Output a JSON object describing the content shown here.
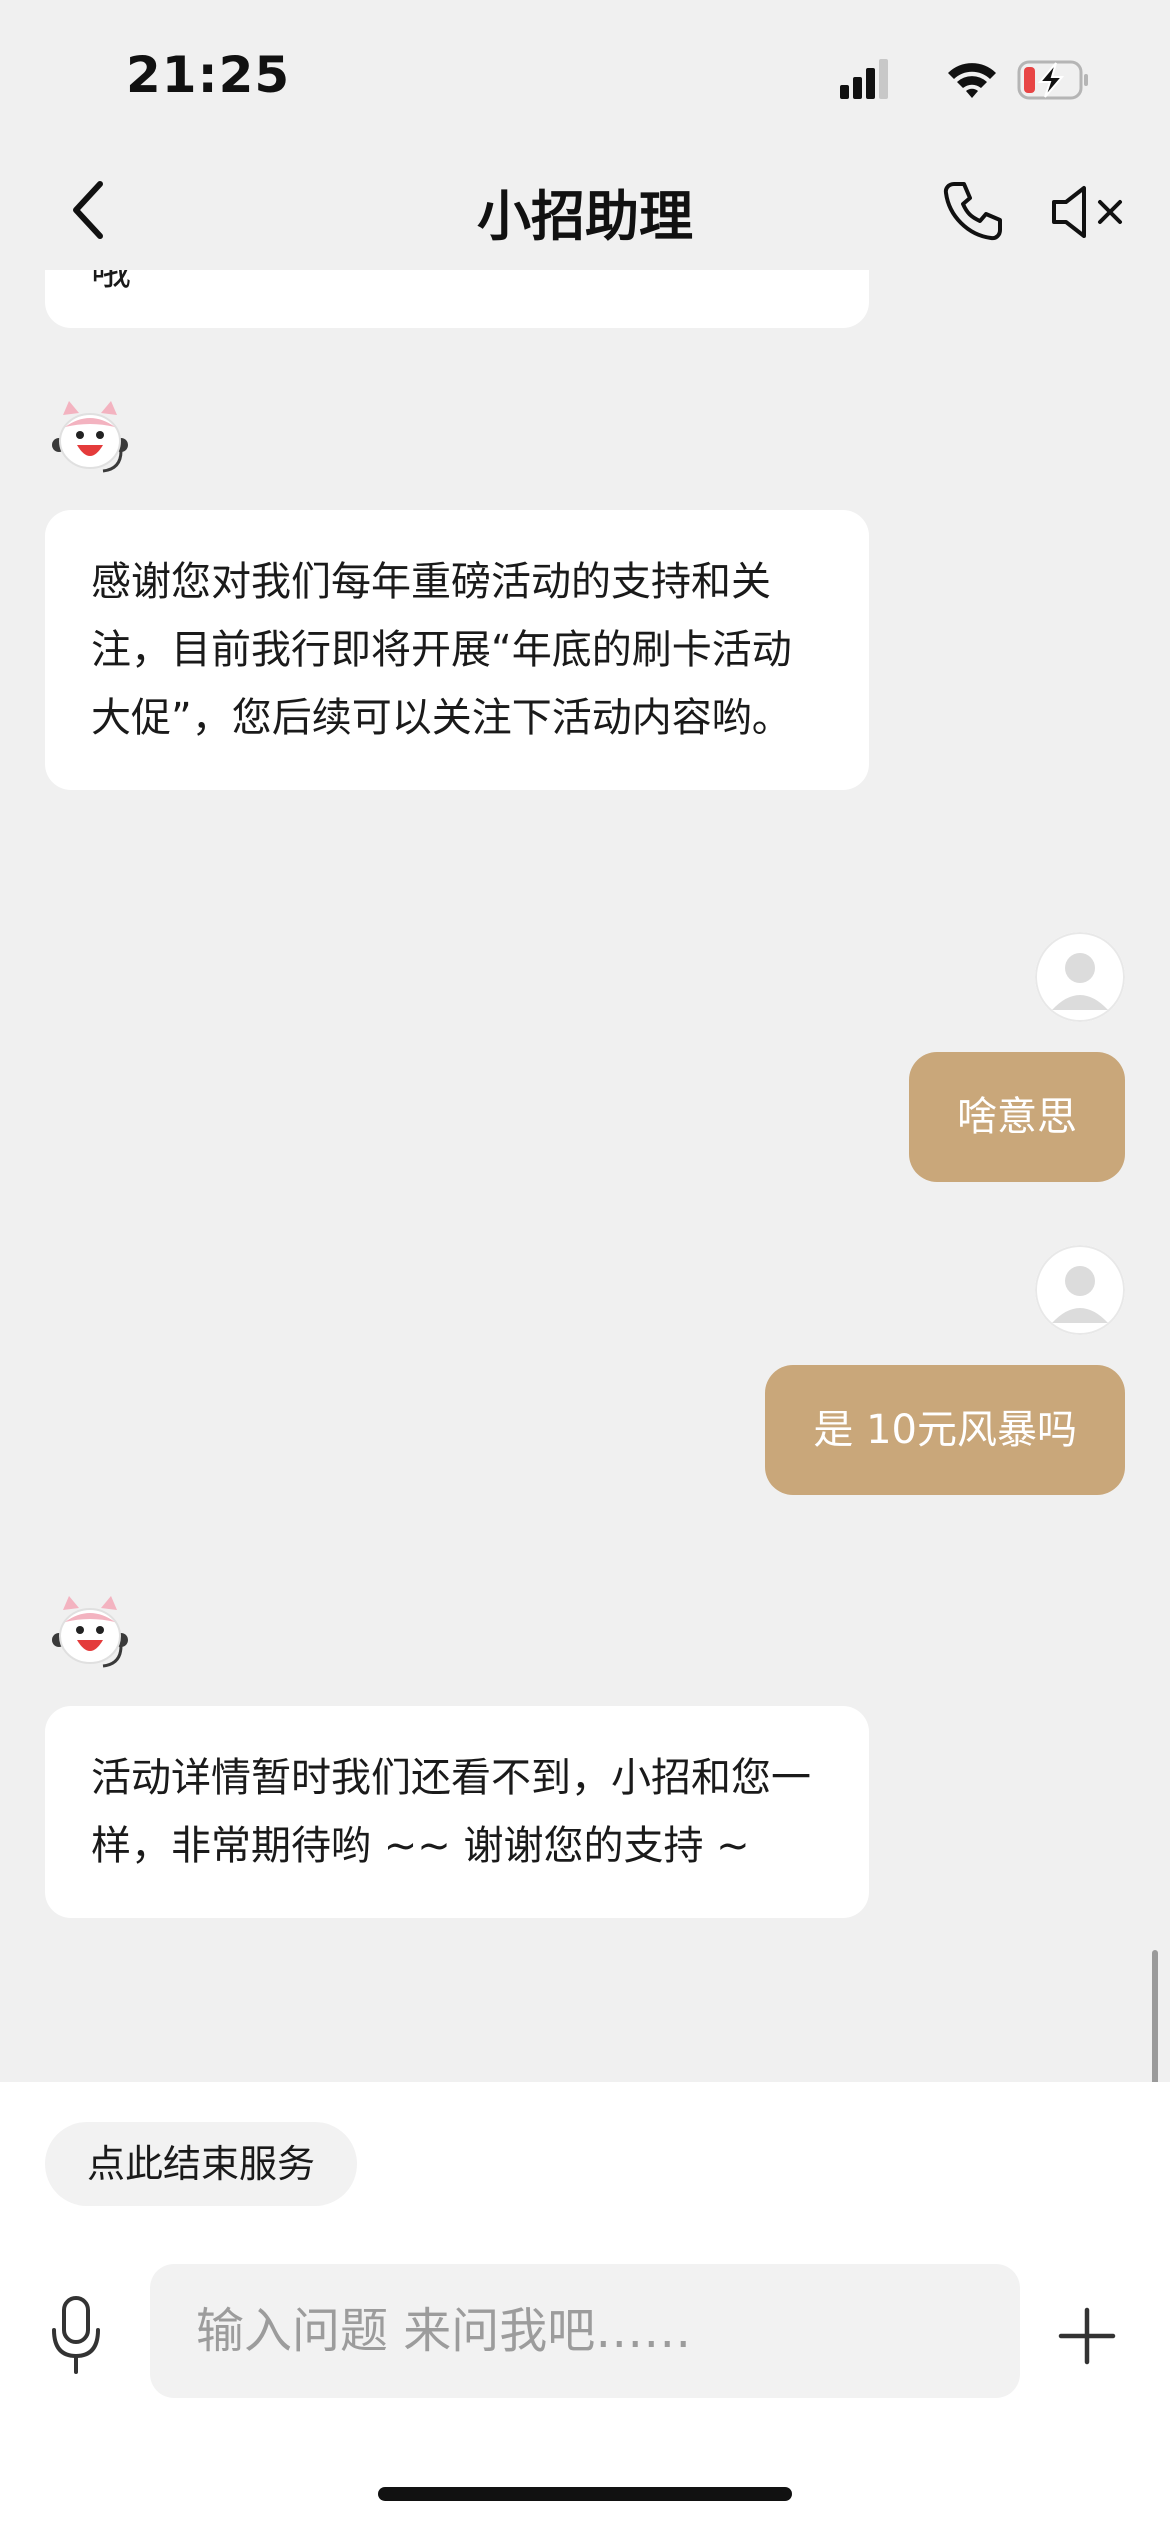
{
  "status_bar": {
    "time": "21:25",
    "icons": [
      "signal-icon",
      "wifi-icon",
      "battery-charging-icon"
    ],
    "battery_color": "#e84545"
  },
  "nav": {
    "title": "小招助理",
    "icons": [
      "back-chevron-icon",
      "phone-icon",
      "speaker-muted-icon"
    ]
  },
  "messages": [
    {
      "side": "left",
      "partial": true,
      "text": "哦"
    },
    {
      "side": "left",
      "text": "感谢您对我们每年重磅活动的支持和关注，目前我行即将开展“年底的刷卡活动大促”，您后续可以关注下活动内容哟。"
    },
    {
      "side": "right",
      "text": "啥意思"
    },
    {
      "side": "right",
      "text": "是 10元风暴吗"
    },
    {
      "side": "left",
      "text": "活动详情暂时我们还看不到，小招和您一样，非常期待哟 ~~ 谢谢您的支持 ~"
    }
  ],
  "bottom": {
    "end_service_label": "点此结束服务",
    "input_placeholder": "输入问题 来问我吧……",
    "icons": [
      "microphone-icon",
      "plus-icon"
    ]
  },
  "colors": {
    "background": "#f0f0f0",
    "user_bubble": "#c9a77a",
    "bot_bubble": "#ffffff"
  }
}
